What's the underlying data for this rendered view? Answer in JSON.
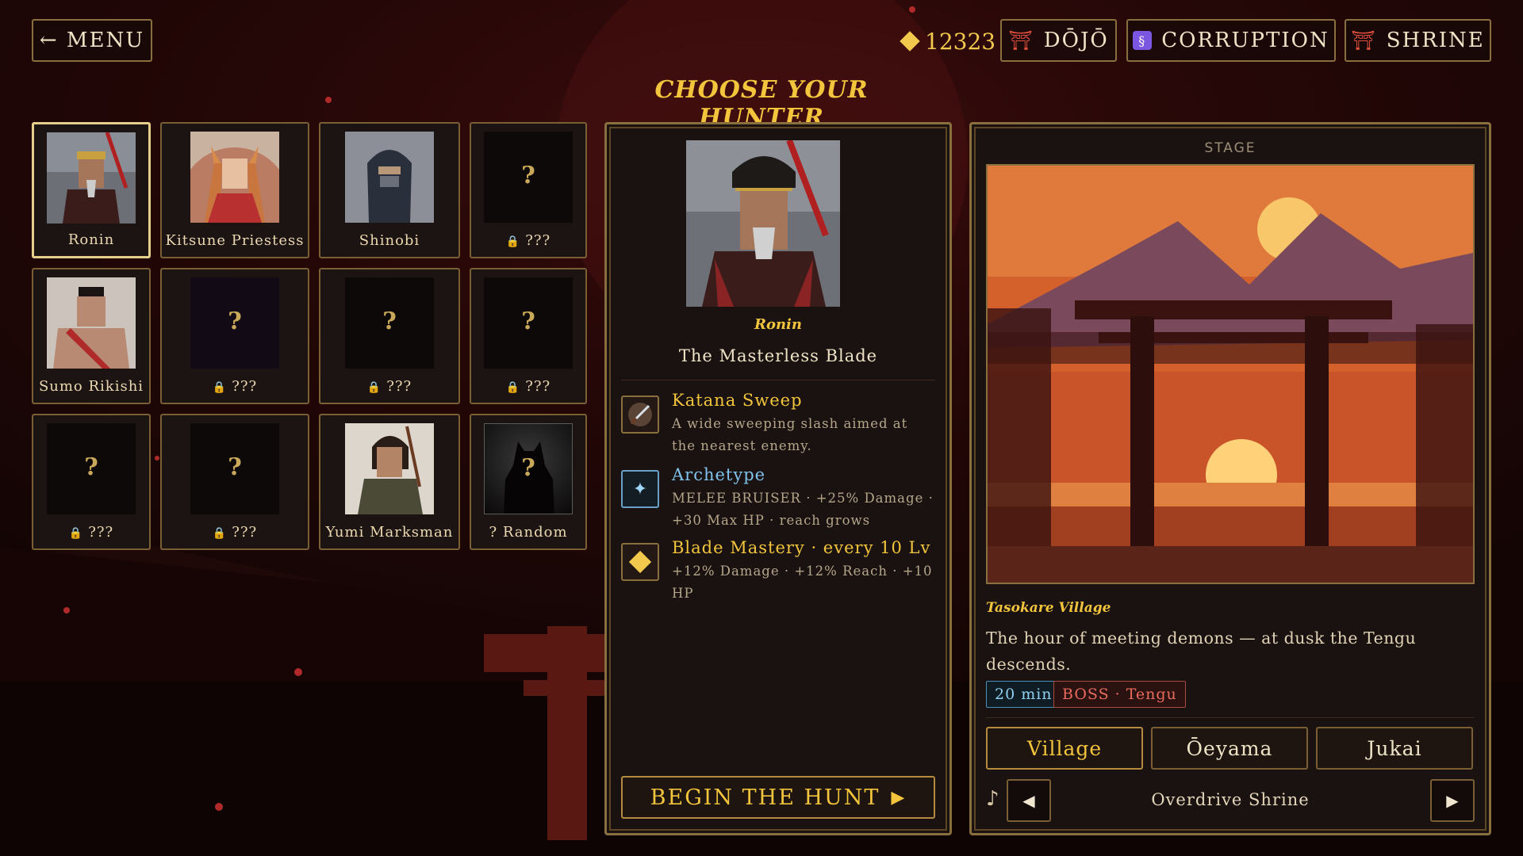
{
  "topbar": {
    "menu_label": "← MENU",
    "coins": "12323",
    "dojo_label": "DŌJŌ",
    "corruption_label": "CORRUPTION",
    "shrine_label": "SHRINE"
  },
  "title": "CHOOSE YOUR HUNTER",
  "hunters": [
    {
      "name": "Ronin",
      "locked": false,
      "selected": true
    },
    {
      "name": "Kitsune Priestess",
      "locked": false
    },
    {
      "name": "Shinobi",
      "locked": false
    },
    {
      "name": "???",
      "locked": true
    },
    {
      "name": "Sumo Rikishi",
      "locked": false
    },
    {
      "name": "???",
      "locked": true
    },
    {
      "name": "???",
      "locked": true
    },
    {
      "name": "???",
      "locked": true
    },
    {
      "name": "???",
      "locked": true
    },
    {
      "name": "???",
      "locked": true
    },
    {
      "name": "Yumi Marksman",
      "locked": false
    },
    {
      "name": "? Random",
      "locked": false
    }
  ],
  "detail": {
    "name": "Ronin",
    "subtitle": "The Masterless Blade",
    "abilities": [
      {
        "title": "Katana Sweep",
        "desc": "A wide sweeping slash aimed at the nearest enemy.",
        "icon": "katana-icon"
      },
      {
        "title": "Archetype",
        "desc": "MELEE BRUISER · +25% Damage · +30 Max HP · reach grows",
        "icon": "star-icon"
      },
      {
        "title": "Blade Mastery · every 10 Lv",
        "desc": "+12% Damage · +12% Reach · +10 HP",
        "icon": "diamond-icon"
      }
    ],
    "begin_label": "BEGIN THE HUNT"
  },
  "stage": {
    "label": "STAGE",
    "name": "Tasokare Village",
    "desc": "The hour of meeting demons — at dusk the Tengu descends.",
    "time_tag": "20 min",
    "boss_tag": "BOSS · Tengu",
    "tabs": [
      "Village",
      "Ōeyama",
      "Jukai"
    ],
    "active_tab": "Village",
    "music": "Overdrive Shrine"
  },
  "colors": {
    "accent": "#f2c53d",
    "border": "#8a6f3e",
    "bg": "#250707"
  }
}
